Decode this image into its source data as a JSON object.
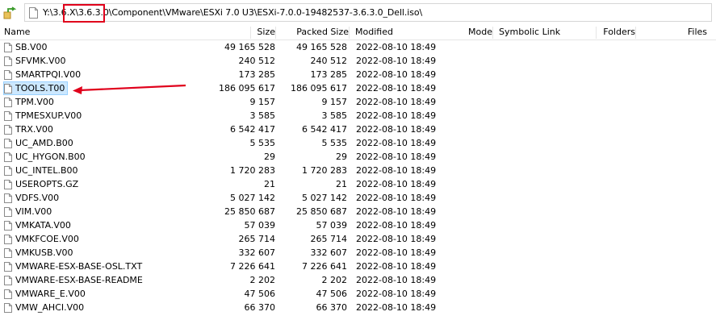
{
  "path": "Y:\\3.6.X\\3.6.3.0\\Component\\VMware\\ESXi 7.0 U3\\ESXi-7.0.0-19482537-3.6.3.0_Dell.iso\\",
  "columns": {
    "name": "Name",
    "size": "Size",
    "packed": "Packed Size",
    "modified": "Modified",
    "mode": "Mode",
    "symlink": "Symbolic Link",
    "folders": "Folders",
    "files": "Files"
  },
  "files": [
    {
      "name": "SB.V00",
      "size": "49 165 528",
      "packed": "49 165 528",
      "modified": "2022-08-10 18:49",
      "selected": false
    },
    {
      "name": "SFVMK.V00",
      "size": "240 512",
      "packed": "240 512",
      "modified": "2022-08-10 18:49",
      "selected": false
    },
    {
      "name": "SMARTPQI.V00",
      "size": "173 285",
      "packed": "173 285",
      "modified": "2022-08-10 18:49",
      "selected": false
    },
    {
      "name": "TOOLS.T00",
      "size": "186 095 617",
      "packed": "186 095 617",
      "modified": "2022-08-10 18:49",
      "selected": true
    },
    {
      "name": "TPM.V00",
      "size": "9 157",
      "packed": "9 157",
      "modified": "2022-08-10 18:49",
      "selected": false
    },
    {
      "name": "TPMESXUP.V00",
      "size": "3 585",
      "packed": "3 585",
      "modified": "2022-08-10 18:49",
      "selected": false
    },
    {
      "name": "TRX.V00",
      "size": "6 542 417",
      "packed": "6 542 417",
      "modified": "2022-08-10 18:49",
      "selected": false
    },
    {
      "name": "UC_AMD.B00",
      "size": "5 535",
      "packed": "5 535",
      "modified": "2022-08-10 18:49",
      "selected": false
    },
    {
      "name": "UC_HYGON.B00",
      "size": "29",
      "packed": "29",
      "modified": "2022-08-10 18:49",
      "selected": false
    },
    {
      "name": "UC_INTEL.B00",
      "size": "1 720 283",
      "packed": "1 720 283",
      "modified": "2022-08-10 18:49",
      "selected": false
    },
    {
      "name": "USEROPTS.GZ",
      "size": "21",
      "packed": "21",
      "modified": "2022-08-10 18:49",
      "selected": false
    },
    {
      "name": "VDFS.V00",
      "size": "5 027 142",
      "packed": "5 027 142",
      "modified": "2022-08-10 18:49",
      "selected": false
    },
    {
      "name": "VIM.V00",
      "size": "25 850 687",
      "packed": "25 850 687",
      "modified": "2022-08-10 18:49",
      "selected": false
    },
    {
      "name": "VMKATA.V00",
      "size": "57 039",
      "packed": "57 039",
      "modified": "2022-08-10 18:49",
      "selected": false
    },
    {
      "name": "VMKFCOE.V00",
      "size": "265 714",
      "packed": "265 714",
      "modified": "2022-08-10 18:49",
      "selected": false
    },
    {
      "name": "VMKUSB.V00",
      "size": "332 607",
      "packed": "332 607",
      "modified": "2022-08-10 18:49",
      "selected": false
    },
    {
      "name": "VMWARE-ESX-BASE-OSL.TXT",
      "size": "7 226 641",
      "packed": "7 226 641",
      "modified": "2022-08-10 18:49",
      "selected": false
    },
    {
      "name": "VMWARE-ESX-BASE-README",
      "size": "2 202",
      "packed": "2 202",
      "modified": "2022-08-10 18:49",
      "selected": false
    },
    {
      "name": "VMWARE_E.V00",
      "size": "47 506",
      "packed": "47 506",
      "modified": "2022-08-10 18:49",
      "selected": false
    },
    {
      "name": "VMW_AHCI.V00",
      "size": "66 370",
      "packed": "66 370",
      "modified": "2022-08-10 18:49",
      "selected": false
    }
  ],
  "icons": {
    "up": "folder-up-icon",
    "file": "file-icon",
    "path": "file-icon"
  },
  "colors": {
    "selection": "#cce8ff",
    "annotation": "#e0001b",
    "up_arrow": "#3a9b2a"
  }
}
